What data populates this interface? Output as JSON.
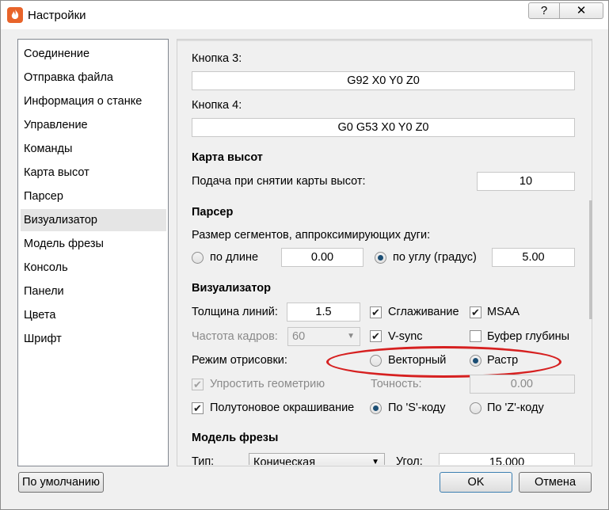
{
  "window": {
    "title": "Настройки",
    "help_label": "?",
    "close_label": "✕",
    "app_icon": "flame-icon"
  },
  "sidebar": {
    "items": [
      "Соединение",
      "Отправка файла",
      "Информация о станке",
      "Управление",
      "Команды",
      "Карта высот",
      "Парсер",
      "Визуализатор",
      "Модель фрезы",
      "Консоль",
      "Панели",
      "Цвета",
      "Шрифт"
    ],
    "selected": "Визуализатор"
  },
  "buttons_section": {
    "btn3_label": "Кнопка 3:",
    "btn3_value": "G92 X0 Y0 Z0",
    "btn4_label": "Кнопка 4:",
    "btn4_value": "G0 G53 X0 Y0 Z0"
  },
  "heightmap": {
    "header": "Карта высот",
    "feed_label": "Подача при снятии карты высот:",
    "feed_value": "10"
  },
  "parser": {
    "header": "Парсер",
    "segments_label": "Размер сегментов, аппроксимирующих дуги:",
    "by_length_label": "по длине",
    "by_length_value": "0.00",
    "by_angle_label": "по углу (градус)",
    "by_angle_value": "5.00"
  },
  "visualizer": {
    "header": "Визуализатор",
    "line_width_label": "Толщина линий:",
    "line_width_value": "1.5",
    "antialiasing_label": "Сглаживание",
    "msaa_label": "MSAA",
    "fps_label": "Частота кадров:",
    "fps_value": "60",
    "vsync_label": "V-sync",
    "zbuffer_label": "Буфер глубины",
    "draw_mode_label": "Режим отрисовки:",
    "vector_label": "Векторный",
    "raster_label": "Растр",
    "simplify_label": "Упростить геометрию",
    "precision_label": "Точность:",
    "precision_value": "0.00",
    "grayscale_label": "Полутоновое окрашивание",
    "by_s_label": "По 'S'-коду",
    "by_z_label": "По 'Z'-коду"
  },
  "tool_model": {
    "header": "Модель фрезы",
    "type_label": "Тип:",
    "type_value": "Коническая",
    "angle_label": "Угол:",
    "angle_value": "15.000"
  },
  "footer": {
    "defaults_label": "По умолчанию",
    "ok_label": "OK",
    "cancel_label": "Отмена"
  },
  "colors": {
    "annotation": "#d62020",
    "selection": "#e5e5e5",
    "radio_dot": "#1b4e74"
  }
}
